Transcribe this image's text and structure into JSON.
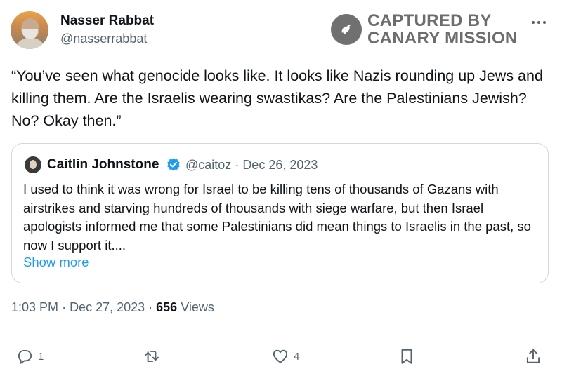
{
  "author": {
    "name": "Nasser Rabbat",
    "handle": "@nasserrabbat"
  },
  "watermark": {
    "line1": "CAPTURED BY",
    "line2": "CANARY MISSION"
  },
  "tweet": {
    "text": "“You’ve seen what genocide looks like. It looks like Nazis rounding up Jews and killing them. Are the Israelis wearing swastikas? Are the Palestinians Jewish? No? Okay then.”",
    "time": "1:03 PM",
    "date": "Dec 27, 2023",
    "views_count": "656",
    "views_label": "Views"
  },
  "quote": {
    "name": "Caitlin Johnstone",
    "handle": "@caitoz",
    "date": "Dec 26, 2023",
    "text": "I used to think it was wrong for Israel to be killing tens of thousands of Gazans with airstrikes and starving hundreds of thousands with siege warfare, but then Israel apologists informed me that some Palestinians did mean things to Israelis in the past, so now I support it....",
    "show_more": "Show more"
  },
  "actions": {
    "reply_count": "1",
    "like_count": "4"
  },
  "icons": {
    "more": "more-icon",
    "verified": "verified-icon",
    "reply": "reply-icon",
    "retweet": "retweet-icon",
    "like": "heart-icon",
    "bookmark": "bookmark-icon",
    "share": "share-icon"
  },
  "colors": {
    "link": "#1d9bf0",
    "secondary_text": "#536471",
    "verified": "#1d9bf0"
  }
}
